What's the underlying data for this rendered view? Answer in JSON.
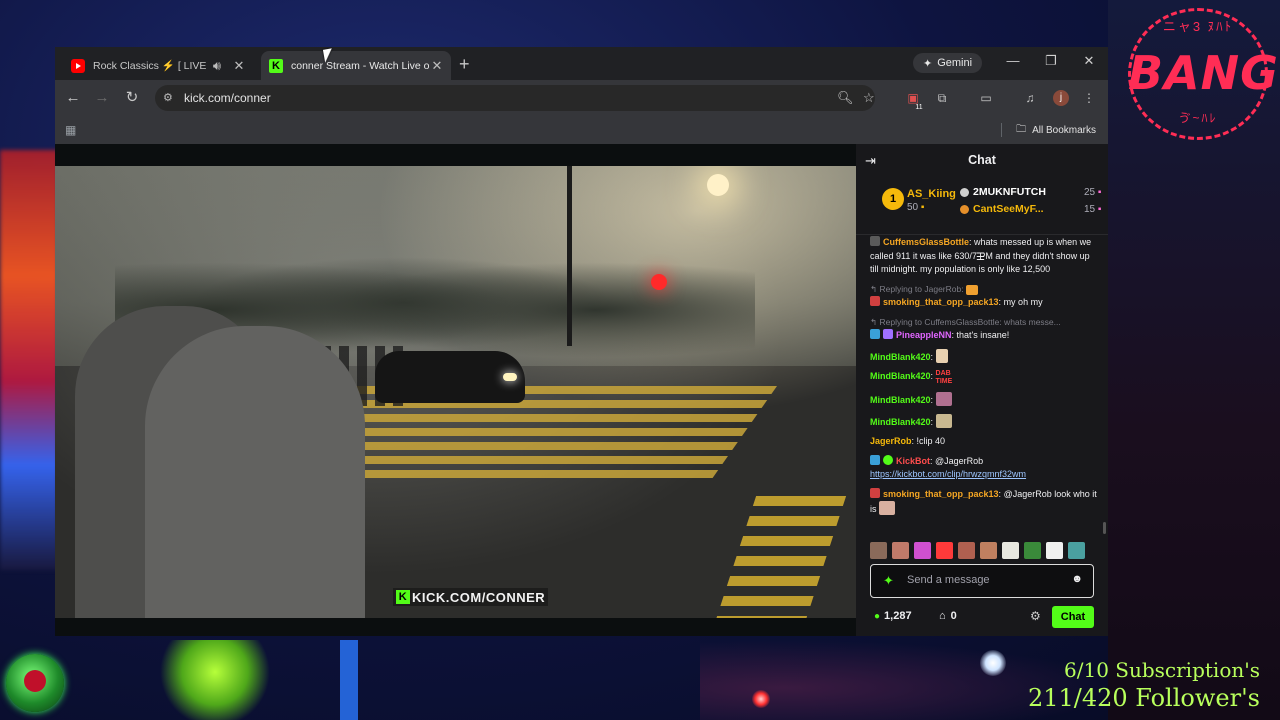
{
  "overlay": {
    "logo_top_text": "ニャ3 ﾇﾊﾄ",
    "logo_text": "BANG",
    "logo_bottom_text": "ゔ~ﾊﾚ",
    "sub_goal": "6/10 Subscription's",
    "follower_goal": "211/420 Follower's"
  },
  "browser": {
    "tabs": [
      {
        "title": "Rock Classics ⚡ [ LIVE ] Ti",
        "favicon": "youtube-icon",
        "audio": true
      },
      {
        "title": "conner Stream - Watch Live on",
        "favicon": "kick-icon",
        "active": true
      }
    ],
    "gemini_label": "Gemini",
    "url": "kick.com/conner",
    "extension_badge": "11",
    "profile_initial": "j",
    "all_bookmarks": "All Bookmarks"
  },
  "video": {
    "watermark": "KICK.COM/CONNER",
    "watermark_icon": "K"
  },
  "chat": {
    "title": "Chat",
    "leaderboard": {
      "first": {
        "rank": "1",
        "name": "AS_Kiing",
        "count": "50"
      },
      "others": [
        {
          "name": "2MUKNFUTCH",
          "count": "25",
          "color": "#ffffff"
        },
        {
          "name": "CantSeeMyF...",
          "count": "15",
          "color": "#f5b90b"
        }
      ]
    },
    "messages": [
      {
        "user": "CuffemsGlassBottle",
        "user_color": "#f5a623",
        "text": "whats messed up is when we called 911 it was like 630/7 PM and they didn't show up till midnight. my population is only like 12,500"
      },
      {
        "reply": "Replying to JagerRob:",
        "user": "smoking_that_opp_pack13",
        "user_color": "#f5a623",
        "text": "my oh my"
      },
      {
        "reply": "Replying to CuffemsGlassBottle: whats messe...",
        "user": "PineappleNN",
        "user_color": "#e066ff",
        "text": "that's insane!"
      },
      {
        "user": "MindBlank420",
        "user_color": "#53fc18",
        "text": ""
      },
      {
        "user": "MindBlank420",
        "user_color": "#53fc18",
        "text": "",
        "emote_text": "DAB TIME"
      },
      {
        "user": "MindBlank420",
        "user_color": "#53fc18",
        "text": ""
      },
      {
        "user": "MindBlank420",
        "user_color": "#53fc18",
        "text": ""
      },
      {
        "user": "JagerRob",
        "user_color": "#f5b90b",
        "text": "!clip 40"
      },
      {
        "user": "KickBot",
        "user_color": "#ff4d4d",
        "text": "@JagerRob",
        "link": "https://kickbot.com/clip/hrwzqmnf32wm"
      },
      {
        "user": "smoking_that_opp_pack13",
        "user_color": "#f5a623",
        "text": "@JagerRob look who it is"
      }
    ],
    "input_placeholder": "Send a message",
    "viewer_count": "1,287",
    "shop_count": "0",
    "send_label": "Chat",
    "accent": "#53fc18"
  }
}
